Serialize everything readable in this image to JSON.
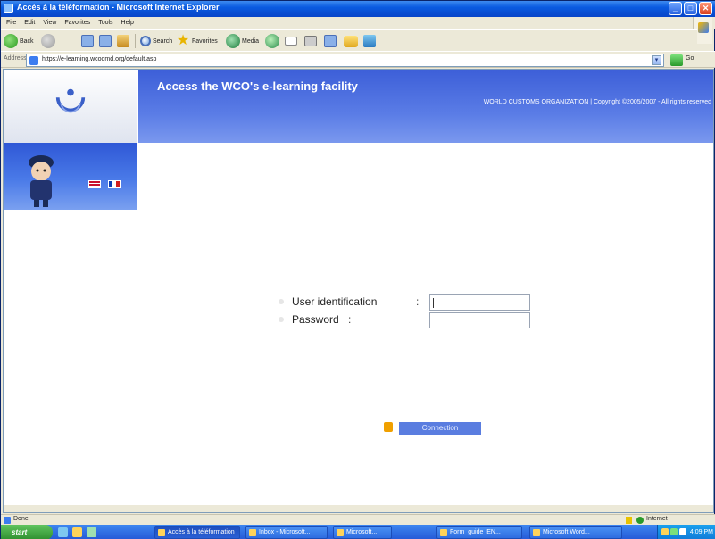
{
  "window": {
    "title": "Accès à la téléformation - Microsoft Internet Explorer",
    "controls": [
      "_",
      "□",
      "✕"
    ]
  },
  "menubar": {
    "items": [
      "File",
      "Edit",
      "View",
      "Favorites",
      "Tools",
      "Help"
    ]
  },
  "toolbar": {
    "back_label": "Back",
    "search_label": "Search",
    "favorites_label": "Favorites",
    "media_label": "Media"
  },
  "addressbar": {
    "label": "Address",
    "url": "https://e-learning.wcoomd.org/default.asp",
    "go_label": "Go",
    "dropdown_glyph": "▾"
  },
  "page": {
    "banner_heading": "Access the WCO's e-learning facility",
    "banner_sub": "WORLD CUSTOMS ORGANIZATION | Copyright ©2005/2007 - All rights reserved",
    "login": {
      "user_label": "User identification",
      "password_label": "Password",
      "colon": ":",
      "user_value": "",
      "password_value": ""
    },
    "connect_label": "Connection"
  },
  "statusbar": {
    "text": "Done",
    "zone": "Internet"
  },
  "taskbar": {
    "start_label": "start",
    "tasks": [
      {
        "label": "Accès à la téléformation",
        "active": true
      },
      {
        "label": "Inbox - Microsoft...",
        "active": false
      },
      {
        "label": "Microsoft...",
        "active": false
      },
      {
        "label": "Form_guide_EN...",
        "active": false
      },
      {
        "label": "Microsoft Word...",
        "active": false
      }
    ],
    "clock": "4:09 PM"
  },
  "colors": {
    "banner": "#4a6ce0",
    "mascot_bg": "#3a66de",
    "connect_button": "#5a7de0"
  }
}
